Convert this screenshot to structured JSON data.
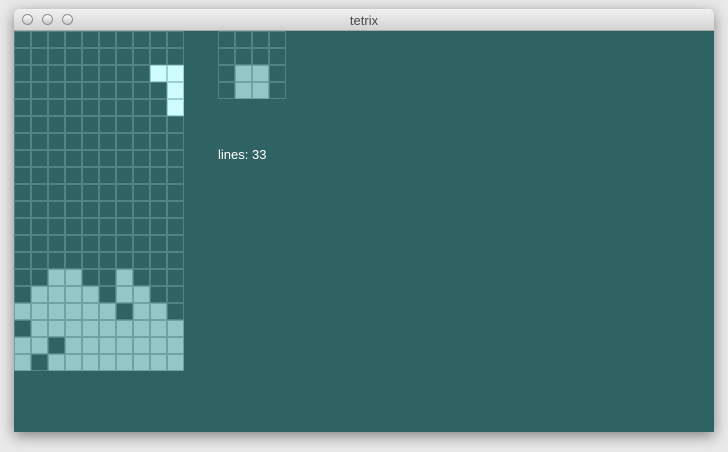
{
  "window": {
    "title": "tetrix"
  },
  "status": {
    "lines_label": "lines:",
    "lines_value": "33"
  },
  "colors": {
    "background": "#2f6262",
    "grid_line": "#538282",
    "locked_block": "#93c7c7",
    "active_block": "#cffdfd"
  },
  "board": {
    "cols": 10,
    "rows": 20,
    "active_cells": [
      [
        8,
        2
      ],
      [
        9,
        2
      ],
      [
        9,
        3
      ],
      [
        9,
        4
      ]
    ],
    "locked_rows": [
      "..........",
      "..........",
      "..........",
      "..........",
      "..........",
      "..........",
      "..........",
      "..........",
      "..........",
      "..........",
      "..........",
      "..........",
      "..........",
      "..........",
      "..##..#...",
      ".####.##..",
      "######.##.",
      ".#########",
      "##.#######",
      "#.########"
    ]
  },
  "next_piece": {
    "cols": 4,
    "rows": 4,
    "cells": [
      [
        1,
        2
      ],
      [
        2,
        2
      ],
      [
        1,
        3
      ],
      [
        2,
        3
      ]
    ]
  }
}
